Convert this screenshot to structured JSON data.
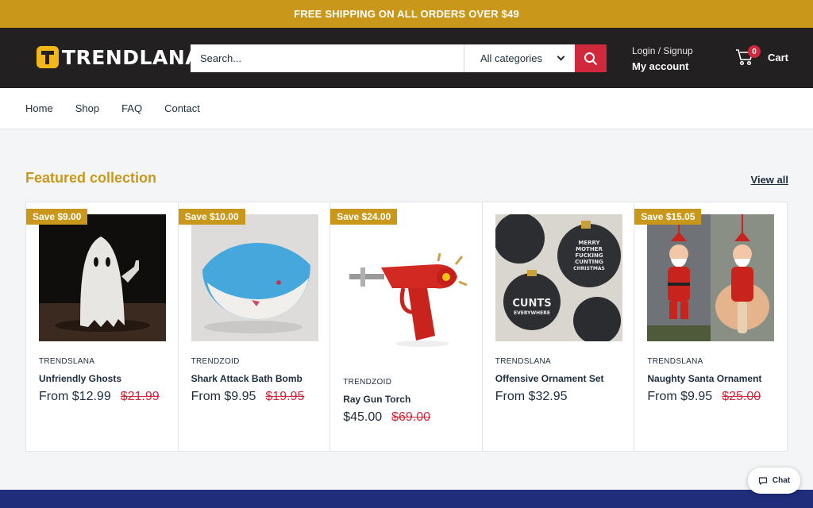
{
  "announcement": "FREE SHIPPING ON ALL ORDERS OVER $49",
  "brand": {
    "name": "TRENDLANA",
    "accent": "#c9981b",
    "logo_mark": "#f2b71a"
  },
  "search": {
    "placeholder": "Search...",
    "category": "All categories"
  },
  "account": {
    "line1": "Login / Signup",
    "line2": "My account"
  },
  "cart": {
    "count": "0",
    "label": "Cart"
  },
  "nav": [
    "Home",
    "Shop",
    "FAQ",
    "Contact"
  ],
  "featured": {
    "title": "Featured collection",
    "view_all": "View all",
    "products": [
      {
        "badge": "Save $9.00",
        "vendor": "TRENDSLANA",
        "title": "Unfriendly Ghosts",
        "price": "From $12.99",
        "compare": "$21.99"
      },
      {
        "badge": "Save $10.00",
        "vendor": "TRENDZOID",
        "title": "Shark Attack Bath Bomb",
        "price": "From $9.95",
        "compare": "$19.95"
      },
      {
        "badge": "Save $24.00",
        "vendor": "TRENDZOID",
        "title": "Ray Gun Torch",
        "price": "$45.00",
        "compare": "$69.00"
      },
      {
        "badge": "",
        "vendor": "TRENDSLANA",
        "title": "Offensive Ornament Set",
        "price": "From $32.95",
        "compare": ""
      },
      {
        "badge": "Save $15.05",
        "vendor": "TRENDSLANA",
        "title": "Naughty Santa Ornament",
        "price": "From $9.95",
        "compare": "$25.00"
      }
    ]
  },
  "ornament_print": [
    "MERRY",
    "MOTHER",
    "FUCKING",
    "CUNTING",
    "CHRISTMAS",
    "CUNTS",
    "EVERYWHERE"
  ],
  "chat": {
    "label": "Chat"
  },
  "colors": {
    "sale_red": "#d1283c",
    "header_bg": "#222021",
    "footer_blue": "#1f2d7b"
  }
}
